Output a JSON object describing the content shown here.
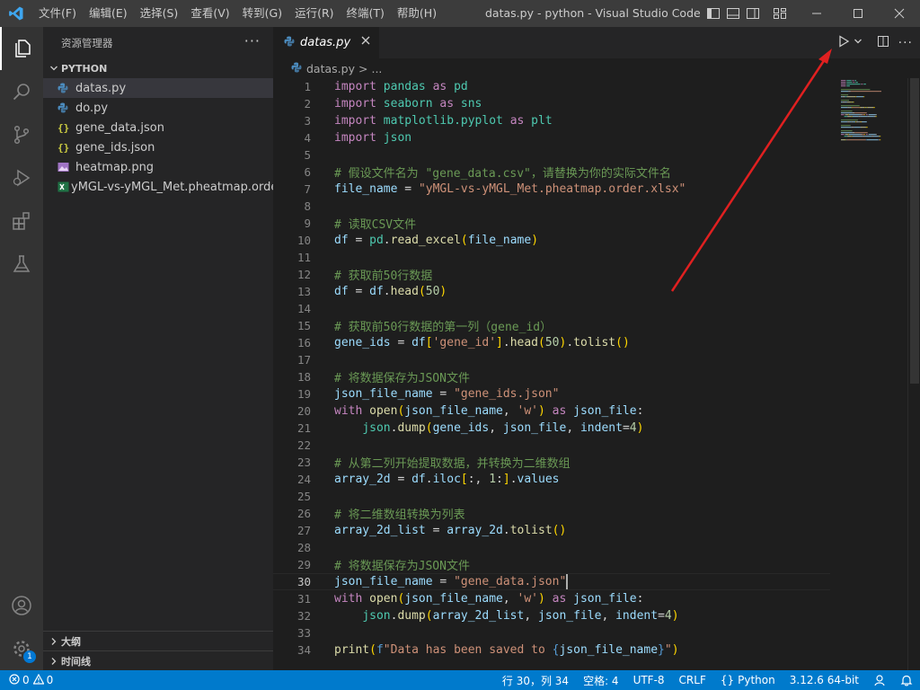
{
  "titlebar": {
    "menu": [
      "文件(F)",
      "编辑(E)",
      "选择(S)",
      "查看(V)",
      "转到(G)",
      "运行(R)",
      "终端(T)",
      "帮助(H)"
    ],
    "title": "datas.py - python - Visual Studio Code"
  },
  "sidebar": {
    "header": "资源管理器",
    "more": "···",
    "folder": "PYTHON",
    "files": [
      {
        "name": "datas.py",
        "icon": "python-icon"
      },
      {
        "name": "do.py",
        "icon": "python-icon"
      },
      {
        "name": "gene_data.json",
        "icon": "json-icon"
      },
      {
        "name": "gene_ids.json",
        "icon": "json-icon"
      },
      {
        "name": "heatmap.png",
        "icon": "image-icon"
      },
      {
        "name": "yMGL-vs-yMGL_Met.pheatmap.order...",
        "icon": "excel-icon"
      }
    ],
    "outline": "大纲",
    "timeline": "时间线"
  },
  "editor": {
    "tab": "datas.py",
    "breadcrumb": {
      "file": "datas.py",
      "sep": ">",
      "rest": "..."
    },
    "current_line": 30
  },
  "code_lines": [
    [
      [
        "kw",
        "import"
      ],
      [
        "pl",
        " "
      ],
      [
        "mod",
        "pandas"
      ],
      [
        "pl",
        " "
      ],
      [
        "kw",
        "as"
      ],
      [
        "pl",
        " "
      ],
      [
        "mod",
        "pd"
      ]
    ],
    [
      [
        "kw",
        "import"
      ],
      [
        "pl",
        " "
      ],
      [
        "mod",
        "seaborn"
      ],
      [
        "pl",
        " "
      ],
      [
        "kw",
        "as"
      ],
      [
        "pl",
        " "
      ],
      [
        "mod",
        "sns"
      ]
    ],
    [
      [
        "kw",
        "import"
      ],
      [
        "pl",
        " "
      ],
      [
        "mod",
        "matplotlib.pyplot"
      ],
      [
        "pl",
        " "
      ],
      [
        "kw",
        "as"
      ],
      [
        "pl",
        " "
      ],
      [
        "mod",
        "plt"
      ]
    ],
    [
      [
        "kw",
        "import"
      ],
      [
        "pl",
        " "
      ],
      [
        "mod",
        "json"
      ]
    ],
    [],
    [
      [
        "cm",
        "# 假设文件名为 \"gene_data.csv\"，请替换为你的实际文件名"
      ]
    ],
    [
      [
        "id",
        "file_name"
      ],
      [
        "pl",
        " = "
      ],
      [
        "str",
        "\"yMGL-vs-yMGL_Met.pheatmap.order.xlsx\""
      ]
    ],
    [],
    [
      [
        "cm",
        "# 读取CSV文件"
      ]
    ],
    [
      [
        "id",
        "df"
      ],
      [
        "pl",
        " = "
      ],
      [
        "mod",
        "pd"
      ],
      [
        "pl",
        "."
      ],
      [
        "fn",
        "read_excel"
      ],
      [
        "br1",
        "("
      ],
      [
        "id",
        "file_name"
      ],
      [
        "br1",
        ")"
      ]
    ],
    [],
    [
      [
        "cm",
        "# 获取前50行数据"
      ]
    ],
    [
      [
        "id",
        "df"
      ],
      [
        "pl",
        " = "
      ],
      [
        "id",
        "df"
      ],
      [
        "pl",
        "."
      ],
      [
        "fn",
        "head"
      ],
      [
        "br1",
        "("
      ],
      [
        "num",
        "50"
      ],
      [
        "br1",
        ")"
      ]
    ],
    [],
    [
      [
        "cm",
        "# 获取前50行数据的第一列（gene_id）"
      ]
    ],
    [
      [
        "id",
        "gene_ids"
      ],
      [
        "pl",
        " = "
      ],
      [
        "id",
        "df"
      ],
      [
        "br1",
        "["
      ],
      [
        "str",
        "'gene_id'"
      ],
      [
        "br1",
        "]"
      ],
      [
        "pl",
        "."
      ],
      [
        "fn",
        "head"
      ],
      [
        "br1",
        "("
      ],
      [
        "num",
        "50"
      ],
      [
        "br1",
        ")"
      ],
      [
        "pl",
        "."
      ],
      [
        "fn",
        "tolist"
      ],
      [
        "br1",
        "()"
      ]
    ],
    [],
    [
      [
        "cm",
        "# 将数据保存为JSON文件"
      ]
    ],
    [
      [
        "id",
        "json_file_name"
      ],
      [
        "pl",
        " = "
      ],
      [
        "str",
        "\"gene_ids.json\""
      ]
    ],
    [
      [
        "kw",
        "with"
      ],
      [
        "pl",
        " "
      ],
      [
        "fn",
        "open"
      ],
      [
        "br1",
        "("
      ],
      [
        "id",
        "json_file_name"
      ],
      [
        "pl",
        ", "
      ],
      [
        "str",
        "'w'"
      ],
      [
        "br1",
        ")"
      ],
      [
        "pl",
        " "
      ],
      [
        "kw",
        "as"
      ],
      [
        "pl",
        " "
      ],
      [
        "id",
        "json_file"
      ],
      [
        "pl",
        ":"
      ]
    ],
    [
      [
        "pl",
        "    "
      ],
      [
        "mod",
        "json"
      ],
      [
        "pl",
        "."
      ],
      [
        "fn",
        "dump"
      ],
      [
        "br1",
        "("
      ],
      [
        "id",
        "gene_ids"
      ],
      [
        "pl",
        ", "
      ],
      [
        "id",
        "json_file"
      ],
      [
        "pl",
        ", "
      ],
      [
        "id",
        "indent"
      ],
      [
        "pl",
        "="
      ],
      [
        "num",
        "4"
      ],
      [
        "br1",
        ")"
      ]
    ],
    [],
    [
      [
        "cm",
        "# 从第二列开始提取数据，并转换为二维数组"
      ]
    ],
    [
      [
        "id",
        "array_2d"
      ],
      [
        "pl",
        " = "
      ],
      [
        "id",
        "df"
      ],
      [
        "pl",
        "."
      ],
      [
        "id",
        "iloc"
      ],
      [
        "br1",
        "["
      ],
      [
        "pl",
        ":, "
      ],
      [
        "num",
        "1"
      ],
      [
        "pl",
        ":"
      ],
      [
        "br1",
        "]"
      ],
      [
        "pl",
        "."
      ],
      [
        "id",
        "values"
      ]
    ],
    [],
    [
      [
        "cm",
        "# 将二维数组转换为列表"
      ]
    ],
    [
      [
        "id",
        "array_2d_list"
      ],
      [
        "pl",
        " = "
      ],
      [
        "id",
        "array_2d"
      ],
      [
        "pl",
        "."
      ],
      [
        "fn",
        "tolist"
      ],
      [
        "br1",
        "()"
      ]
    ],
    [],
    [
      [
        "cm",
        "# 将数据保存为JSON文件"
      ]
    ],
    [
      [
        "id",
        "json_file_name"
      ],
      [
        "pl",
        " = "
      ],
      [
        "str",
        "\"gene_data.json\""
      ]
    ],
    [
      [
        "kw",
        "with"
      ],
      [
        "pl",
        " "
      ],
      [
        "fn",
        "open"
      ],
      [
        "br1",
        "("
      ],
      [
        "id",
        "json_file_name"
      ],
      [
        "pl",
        ", "
      ],
      [
        "str",
        "'w'"
      ],
      [
        "br1",
        ")"
      ],
      [
        "pl",
        " "
      ],
      [
        "kw",
        "as"
      ],
      [
        "pl",
        " "
      ],
      [
        "id",
        "json_file"
      ],
      [
        "pl",
        ":"
      ]
    ],
    [
      [
        "pl",
        "    "
      ],
      [
        "mod",
        "json"
      ],
      [
        "pl",
        "."
      ],
      [
        "fn",
        "dump"
      ],
      [
        "br1",
        "("
      ],
      [
        "id",
        "array_2d_list"
      ],
      [
        "pl",
        ", "
      ],
      [
        "id",
        "json_file"
      ],
      [
        "pl",
        ", "
      ],
      [
        "id",
        "indent"
      ],
      [
        "pl",
        "="
      ],
      [
        "num",
        "4"
      ],
      [
        "br1",
        ")"
      ]
    ],
    [],
    [
      [
        "fn",
        "print"
      ],
      [
        "br1",
        "("
      ],
      [
        "kw2",
        "f"
      ],
      [
        "str",
        "\"Data has been saved to "
      ],
      [
        "kw2",
        "{"
      ],
      [
        "id",
        "json_file_name"
      ],
      [
        "kw2",
        "}"
      ],
      [
        "str",
        "\""
      ],
      [
        "br1",
        ")"
      ]
    ]
  ],
  "statusbar": {
    "errors": "0",
    "warnings": "0",
    "position": "行 30，列 34",
    "spaces": "空格: 4",
    "encoding": "UTF-8",
    "eol": "CRLF",
    "language": "Python",
    "interpreter": "3.12.6 64-bit"
  },
  "activity_badge": "1",
  "colors": {
    "accent": "#007acc",
    "annotation_arrow": "#e02020"
  }
}
